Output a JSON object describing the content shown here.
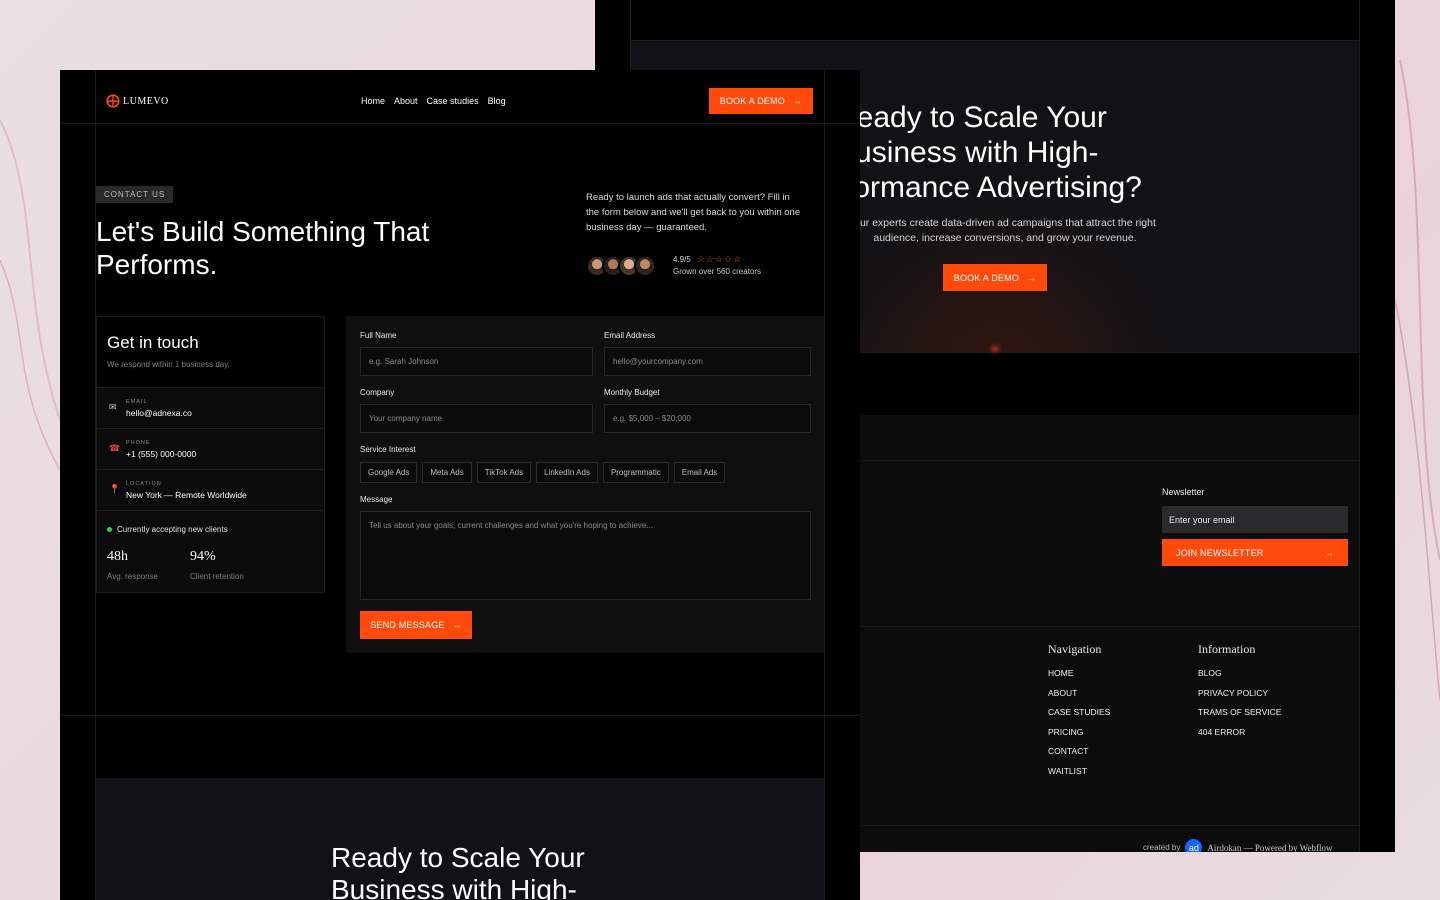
{
  "brand": {
    "name": "LUMEVO",
    "accent": "#ff4a0b"
  },
  "nav": {
    "items": [
      "Home",
      "About",
      "Case studies",
      "Blog"
    ],
    "cta": "BOOK A DEMO"
  },
  "hero": {
    "tag": "CONTACT US",
    "title": "Let's Build Something That Performs.",
    "copy": "Ready to launch ads that actually convert? Fill in the form below and we'll get back to you within one business day — guaranteed.",
    "rating": "4.9/5",
    "rating_note": "Grown over 560 creators"
  },
  "contact_card": {
    "title": "Get in touch",
    "subtitle": "We respond within 1 business day.",
    "rows": [
      {
        "label": "EMAIL",
        "value": "hello@adnexa.co",
        "icon": "mail-icon"
      },
      {
        "label": "PHONE",
        "value": "+1 (555) 000-0000",
        "icon": "phone-icon"
      },
      {
        "label": "LOCATION",
        "value": "New York — Remote Worldwide",
        "icon": "pin-icon"
      }
    ],
    "status": "Currently accepting new clients",
    "stats": [
      {
        "value": "48h",
        "label": "Avg. response"
      },
      {
        "value": "94%",
        "label": "Client retention"
      }
    ]
  },
  "form": {
    "full_name": {
      "label": "Full Name",
      "placeholder": "e.g. Sarah Johnson"
    },
    "email": {
      "label": "Email Address",
      "placeholder": "hello@yourcompany.com"
    },
    "company": {
      "label": "Company",
      "placeholder": "Your company name"
    },
    "budget": {
      "label": "Monthly Budget",
      "placeholder": "e.g. $5,000 – $20,000"
    },
    "service_label": "Service Interest",
    "services": [
      "Google Ads",
      "Meta Ads",
      "TikTok Ads",
      "LinkedIn Ads",
      "Programmatic",
      "Email Ads"
    ],
    "message": {
      "label": "Message",
      "placeholder": "Tell us about your goals, current challenges and what you're hoping to achieve..."
    },
    "submit": "SEND MESSAGE"
  },
  "bottom_cta": {
    "title": "Ready to Scale Your Business with High-"
  },
  "back": {
    "cta": {
      "title": "Ready to Scale Your Business with High-rformance Advertising?",
      "subtitle": "our experts create data-driven ad campaigns that attract the right audience, increase conversions, and grow your revenue.",
      "button": "BOOK A DEMO"
    },
    "newsletter": {
      "label": "Newsletter",
      "placeholder": "Enter your email",
      "button": "JOIN NEWSLETTER"
    },
    "footer": {
      "navigation_title": "Navigation",
      "navigation": [
        "HOME",
        "ABOUT",
        "CASE STUDIES",
        "PRICING",
        "CONTACT",
        "WAITLIST"
      ],
      "information_title": "Information",
      "information": [
        "BLOG",
        "PRIVACY POLICY",
        "TRAMS OF SERVICE",
        "404 ERROR"
      ]
    },
    "credit": {
      "prefix": "created by",
      "badge": "ad",
      "text": "Airdokan — Powered by Webflow"
    }
  }
}
